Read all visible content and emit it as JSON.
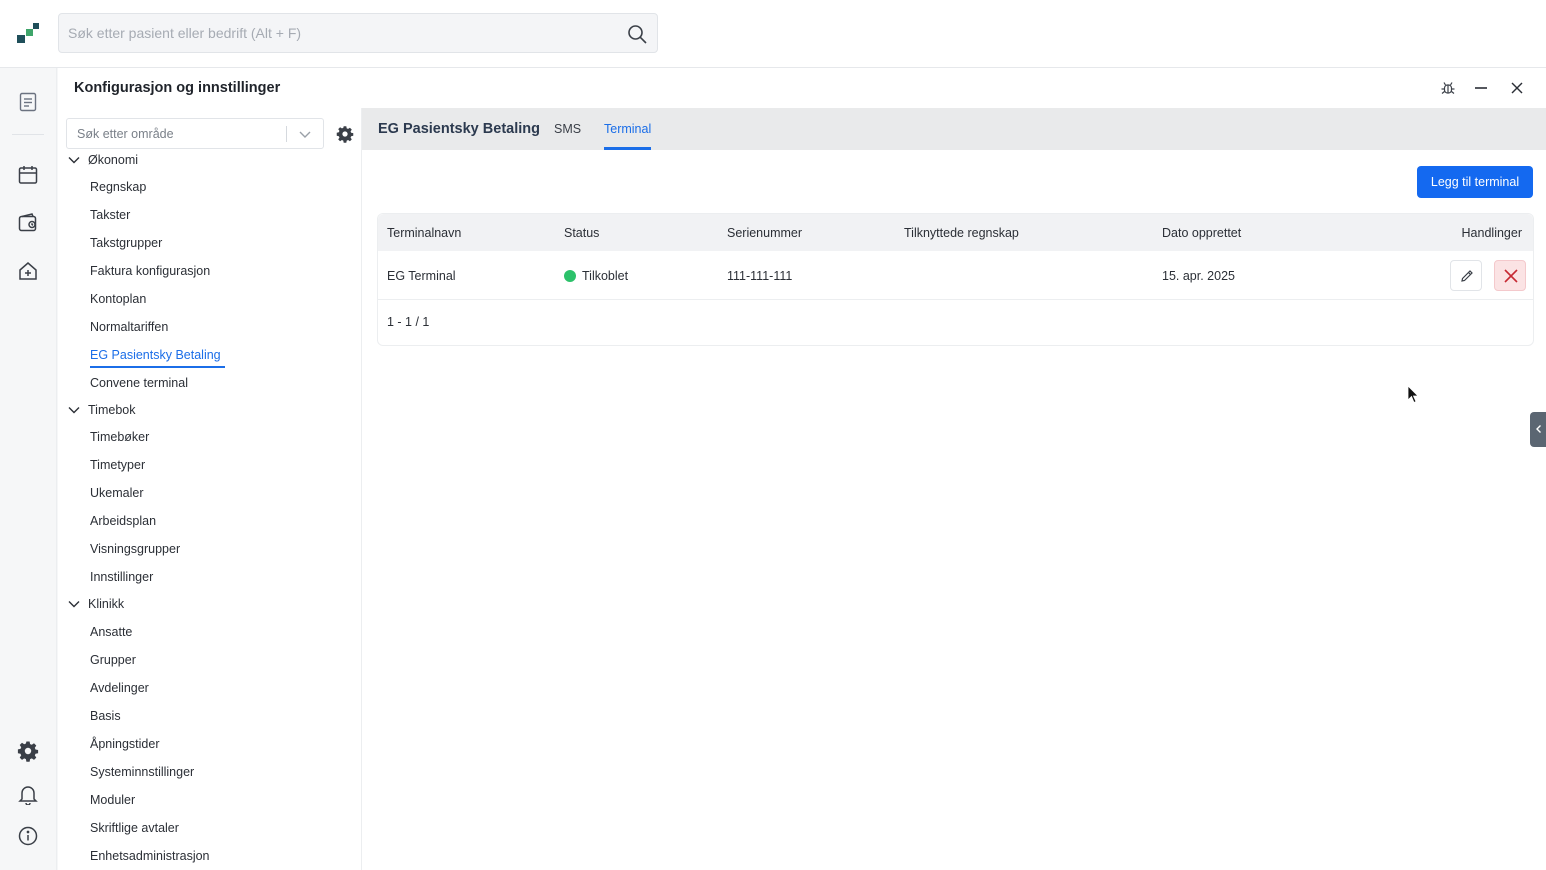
{
  "search": {
    "placeholder": "Søk etter pasient eller bedrift (Alt + F)",
    "icon": "search-icon"
  },
  "panel": {
    "title": "Konfigurasjon og innstillinger"
  },
  "nav": {
    "area_placeholder": "Søk etter område",
    "groups": [
      {
        "label": "Økonomi",
        "items": [
          "Regnskap",
          "Takster",
          "Takstgrupper",
          "Faktura konfigurasjon",
          "Kontoplan",
          "Normaltariffen",
          "EG Pasientsky Betaling",
          "Convene terminal"
        ]
      },
      {
        "label": "Timebok",
        "items": [
          "Timebøker",
          "Timetyper",
          "Ukemaler",
          "Arbeidsplan",
          "Visningsgrupper",
          "Innstillinger"
        ]
      },
      {
        "label": "Klinikk",
        "items": [
          "Ansatte",
          "Grupper",
          "Avdelinger",
          "Basis",
          "Åpningstider",
          "Systeminnstillinger",
          "Moduler",
          "Skriftlige avtaler",
          "Enhetsadministrasjon"
        ]
      }
    ],
    "active_item": "EG Pasientsky Betaling"
  },
  "tabs": {
    "title": "EG Pasientsky Betaling",
    "items": [
      "SMS",
      "Terminal"
    ],
    "active": "Terminal"
  },
  "actions": {
    "add_terminal": "Legg til terminal"
  },
  "table": {
    "headers": [
      "Terminalnavn",
      "Status",
      "Serienummer",
      "Tilknyttede regnskap",
      "Dato opprettet",
      "Handlinger"
    ],
    "rows": [
      {
        "name": "EG Terminal",
        "status": "Tilkoblet",
        "serial": "111-111-111",
        "accounts": "",
        "created": "15. apr. 2025"
      }
    ],
    "pagination": "1 - 1 / 1"
  },
  "colors": {
    "accent": "#1469f0",
    "status_connected": "#2cc16a",
    "delete_bg": "#fbe3e4"
  }
}
